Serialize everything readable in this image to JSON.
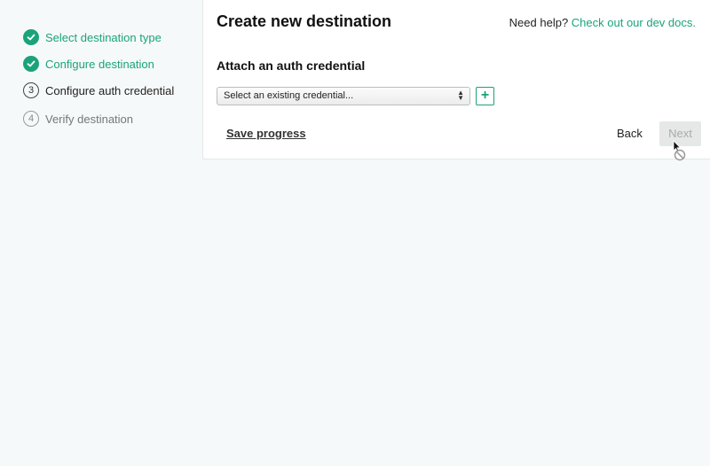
{
  "sidebar": {
    "steps": [
      {
        "number": "1",
        "label": "Select destination type",
        "state": "done"
      },
      {
        "number": "2",
        "label": "Configure destination",
        "state": "done"
      },
      {
        "number": "3",
        "label": "Configure auth credential",
        "state": "current"
      },
      {
        "number": "4",
        "label": "Verify destination",
        "state": "todo"
      }
    ]
  },
  "header": {
    "title": "Create new destination",
    "help_prefix": "Need help?",
    "help_link": "Check out our dev docs."
  },
  "form": {
    "section_title": "Attach an auth credential",
    "credential_select_value": "Select an existing credential...",
    "add_icon": "+"
  },
  "footer": {
    "save_label": "Save progress",
    "back_label": "Back",
    "next_label": "Next"
  },
  "colors": {
    "accent": "#1aa37a",
    "background": "#f6f9f9",
    "panel": "#ffffff",
    "disabled": "#e6e8e8"
  }
}
